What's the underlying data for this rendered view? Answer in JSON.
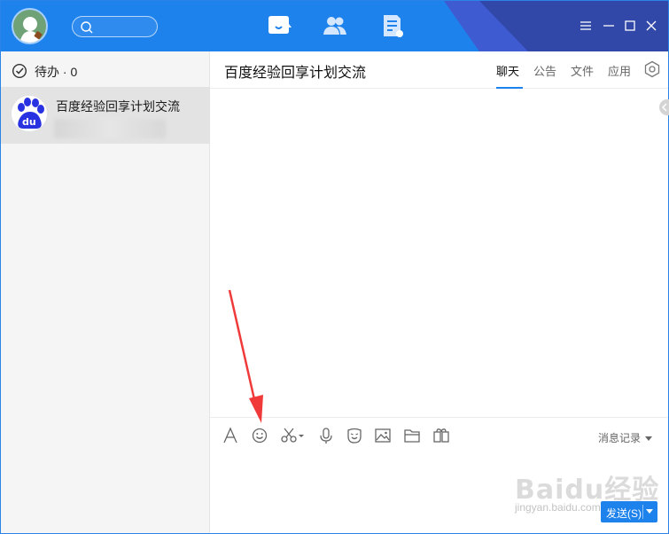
{
  "header": {
    "search_placeholder": "",
    "nav_tabs": [
      {
        "name": "messages",
        "active": true
      },
      {
        "name": "contacts",
        "active": false
      },
      {
        "name": "workspace",
        "active": false
      }
    ],
    "window_controls": [
      "menu",
      "minimize",
      "maximize",
      "close"
    ]
  },
  "sidebar": {
    "todo_label": "待办 · 0",
    "conversations": [
      {
        "name": "百度经验回享计划交流",
        "preview": "",
        "avatar": "baidu-paw-logo"
      }
    ]
  },
  "chat": {
    "title": "百度经验回享计划交流",
    "tabs": [
      {
        "label": "聊天",
        "active": true
      },
      {
        "label": "公告",
        "active": false
      },
      {
        "label": "文件",
        "active": false
      },
      {
        "label": "应用",
        "active": false
      }
    ]
  },
  "toolbar": {
    "tools": [
      "font-icon",
      "emoji-icon",
      "screenshot-scissors-icon",
      "voice-mic-icon",
      "sticker-icon",
      "image-icon",
      "folder-icon",
      "app-box-icon"
    ],
    "history_label": "消息记录"
  },
  "send": {
    "label": "发送(S)"
  },
  "watermark": {
    "text": "Baidu经验",
    "sub": "jingyan.baidu.com"
  },
  "colors": {
    "brand_blue": "#1e82ec",
    "annotation_red": "#f03a3a"
  }
}
